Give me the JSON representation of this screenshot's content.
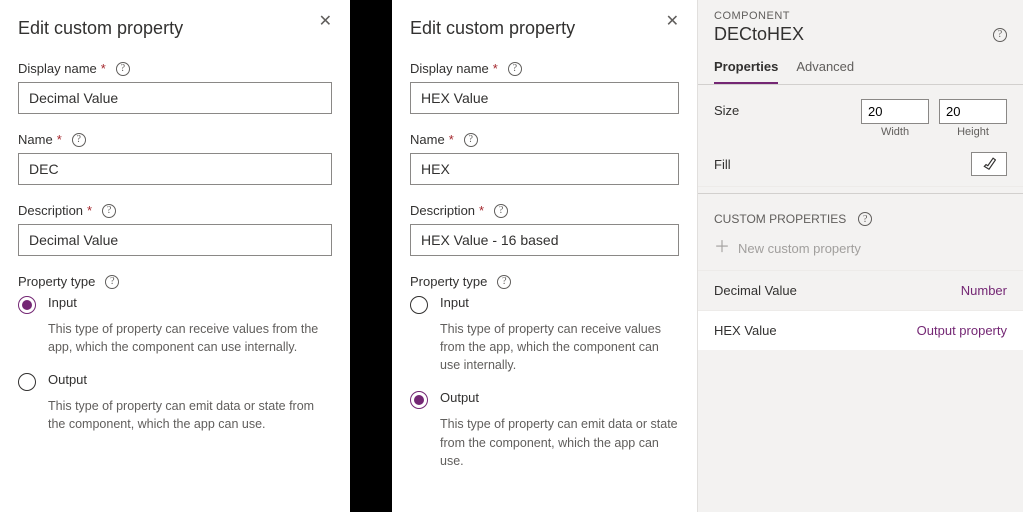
{
  "panel_left": {
    "title": "Edit custom property",
    "display_name_label": "Display name",
    "display_name_value": "Decimal Value",
    "name_label": "Name",
    "name_value": "DEC",
    "description_label": "Description",
    "description_value": "Decimal Value",
    "property_type_label": "Property type",
    "input_label": "Input",
    "input_desc": "This type of property can receive values from the app, which the component can use internally.",
    "output_label": "Output",
    "output_desc": "This type of property can emit data or state from the component, which the app can use.",
    "selected": "input"
  },
  "panel_mid": {
    "title": "Edit custom property",
    "display_name_label": "Display name",
    "display_name_value": "HEX Value",
    "name_label": "Name",
    "name_value": "HEX",
    "description_label": "Description",
    "description_value": "HEX Value - 16 based",
    "property_type_label": "Property type",
    "input_label": "Input",
    "input_desc": "This type of property can receive values from the app, which the component can use internally.",
    "output_label": "Output",
    "output_desc": "This type of property can emit data or state from the component, which the app can use.",
    "selected": "output"
  },
  "panel_right": {
    "section": "COMPONENT",
    "component_name": "DECtoHEX",
    "tabs": {
      "properties": "Properties",
      "advanced": "Advanced"
    },
    "size_label": "Size",
    "width_value": "20",
    "height_value": "20",
    "width_label": "Width",
    "height_label": "Height",
    "fill_label": "Fill",
    "custom_header": "CUSTOM PROPERTIES",
    "new_property": "New custom property",
    "item1_name": "Decimal Value",
    "item1_type": "Number",
    "item2_name": "HEX Value",
    "item2_type": "Output property"
  }
}
